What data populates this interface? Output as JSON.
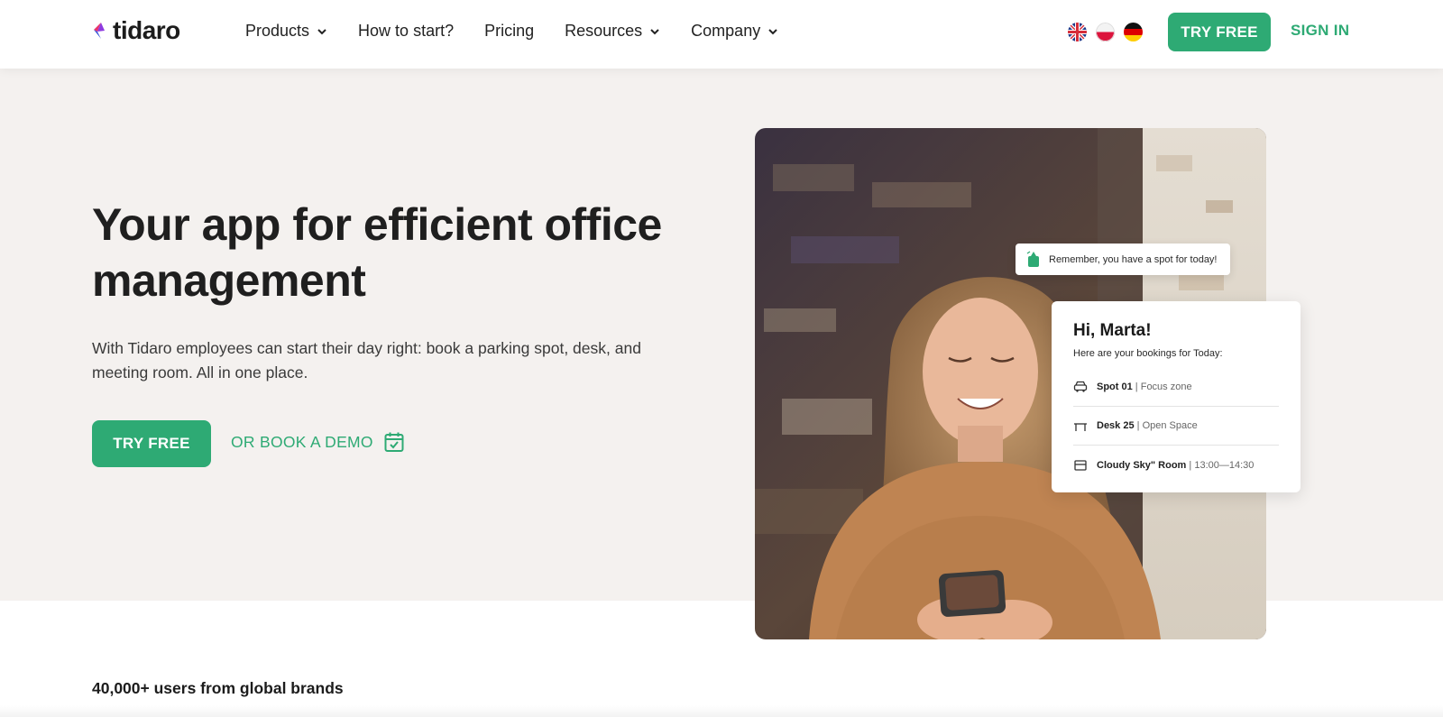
{
  "header": {
    "logo_text": "tidaro",
    "nav": [
      {
        "label": "Products",
        "has_dropdown": true
      },
      {
        "label": "How to start?",
        "has_dropdown": false
      },
      {
        "label": "Pricing",
        "has_dropdown": false
      },
      {
        "label": "Resources",
        "has_dropdown": true
      },
      {
        "label": "Company",
        "has_dropdown": true
      }
    ],
    "languages": [
      "uk-flag-icon",
      "pl-flag-icon",
      "de-flag-icon"
    ],
    "try_free": "TRY FREE",
    "sign_in": "SIGN IN"
  },
  "hero": {
    "title_line1": "Your app for efficient office",
    "title_line2": "management",
    "subtitle": "With Tidaro employees can start their day right: book a parking spot, desk, and meeting room. All in one place.",
    "try_free": "TRY FREE",
    "demo_link": "OR BOOK A DEMO"
  },
  "app_preview": {
    "reminder": "Remember, you have a spot for today!",
    "greeting": "Hi, Marta!",
    "bookings_intro": "Here are your bookings for Today:",
    "bookings": [
      {
        "name": "Spot 01",
        "detail": "Focus zone",
        "icon": "car-icon"
      },
      {
        "name": "Desk 25",
        "detail": "Open Space",
        "icon": "desk-icon"
      },
      {
        "name": "Cloudy Sky\" Room",
        "detail": "13:00—14:30",
        "icon": "room-icon"
      }
    ]
  },
  "social_proof": {
    "text": "40,000+ users from global brands"
  },
  "colors": {
    "brand_green": "#2eaa74",
    "hero_bg": "#f4f1ef"
  }
}
